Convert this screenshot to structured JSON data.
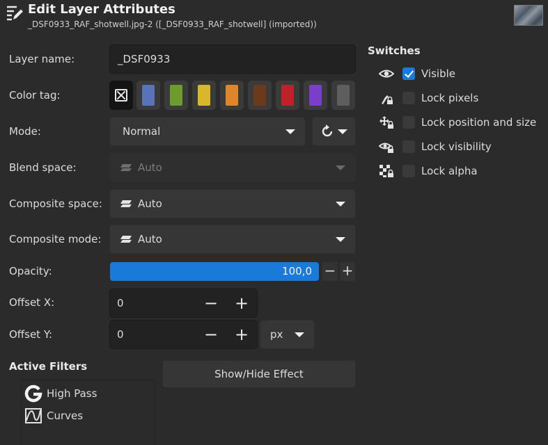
{
  "header": {
    "title": "Edit Layer Attributes",
    "subtitle": "_DSF0933_RAF_shotwell.jpg-2 ([_DSF0933_RAF_shotwell] (imported))"
  },
  "form": {
    "layer_name_label": "Layer name:",
    "layer_name_value": "_DSF0933",
    "color_tag_label": "Color tag:",
    "color_tags": [
      "none",
      "#5a72b8",
      "#6d9b2d",
      "#d9b72b",
      "#e0862a",
      "#6a3a1a",
      "#c0202a",
      "#7a3fc8",
      "#5e5e5e"
    ],
    "mode_label": "Mode:",
    "mode_value": "Normal",
    "blend_space_label": "Blend space:",
    "blend_space_value": "Auto",
    "composite_space_label": "Composite space:",
    "composite_space_value": "Auto",
    "composite_mode_label": "Composite mode:",
    "composite_mode_value": "Auto",
    "opacity_label": "Opacity:",
    "opacity_value": "100,0",
    "opacity_minus": "−",
    "opacity_plus": "+",
    "offset_x_label": "Offset X:",
    "offset_x_value": "0",
    "offset_y_label": "Offset Y:",
    "offset_y_value": "0",
    "unit_value": "px",
    "minus": "−",
    "plus": "+"
  },
  "switches": {
    "title": "Switches",
    "items": [
      {
        "label": "Visible",
        "checked": true,
        "icon": "eye-icon"
      },
      {
        "label": "Lock pixels",
        "checked": false,
        "icon": "brush-lock-icon"
      },
      {
        "label": "Lock position and size",
        "checked": false,
        "icon": "move-lock-icon"
      },
      {
        "label": "Lock visibility",
        "checked": false,
        "icon": "eye-lock-icon"
      },
      {
        "label": "Lock alpha",
        "checked": false,
        "icon": "checkerboard-lock-icon"
      }
    ]
  },
  "filters": {
    "title": "Active Filters",
    "items": [
      {
        "label": "High Pass",
        "icon": "gegl-icon"
      },
      {
        "label": "Curves",
        "icon": "curves-icon"
      }
    ],
    "toggle_button": "Show/Hide Effect"
  }
}
